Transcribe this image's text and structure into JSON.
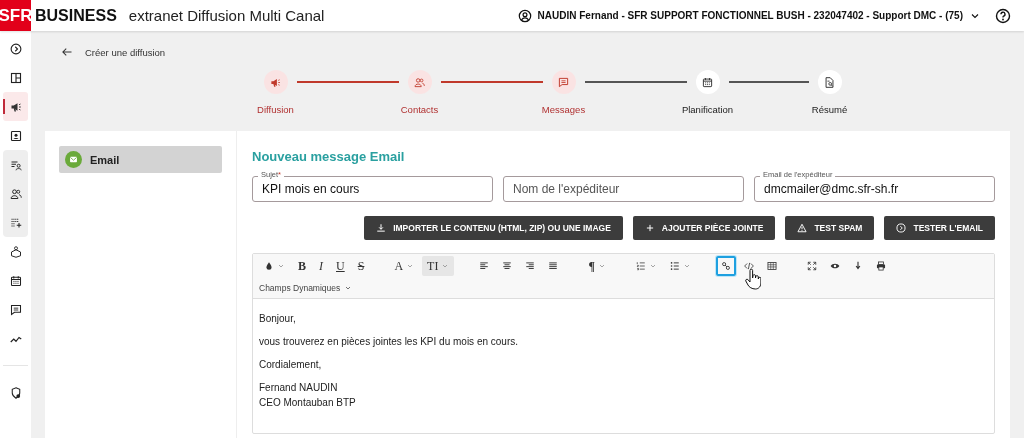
{
  "header": {
    "brand": "SFR",
    "product": "BUSINESS",
    "title": "extranet Diffusion Multi Canal",
    "user": "NAUDIN Fernand - SFR SUPPORT FONCTIONNEL BUSH - 232047402 - Support DMC - (75)"
  },
  "sidebar": {
    "groups": [
      {
        "shaded": false,
        "items": [
          {
            "selected": false
          },
          {
            "selected": false
          },
          {
            "selected": true
          },
          {
            "selected": false
          }
        ]
      },
      {
        "shaded": true,
        "items": [
          {
            "selected": false
          },
          {
            "selected": false
          },
          {
            "selected": false
          }
        ]
      },
      {
        "shaded": false,
        "items": [
          {
            "selected": false
          },
          {
            "selected": false
          },
          {
            "selected": false
          },
          {
            "selected": false
          }
        ]
      },
      {
        "shaded": false,
        "items": [
          {
            "selected": false
          }
        ]
      }
    ]
  },
  "back": {
    "label": "Créer une diffusion"
  },
  "steps": [
    {
      "label": "Diffusion",
      "completed": true
    },
    {
      "label": "Contacts",
      "completed": true
    },
    {
      "label": "Messages",
      "completed": true
    },
    {
      "label": "Planification",
      "completed": false
    },
    {
      "label": "Résumé",
      "completed": false
    }
  ],
  "channels": [
    {
      "label": "Email",
      "selected": true,
      "color": "#6aaa3a"
    }
  ],
  "form": {
    "title": "Nouveau message Email",
    "fields": [
      {
        "label": "Sujet",
        "required_mark": "*",
        "value": "KPI mois en cours"
      },
      {
        "placeholder": "Nom de l'expéditeur"
      },
      {
        "label": "Email de l'expéditeur",
        "value": "dmcmailer@dmc.sfr-sh.fr"
      }
    ],
    "buttons": [
      {
        "label": "IMPORTER LE CONTENU (HTML, ZIP) OU UNE IMAGE"
      },
      {
        "label": "AJOUTER PIÈCE JOINTE"
      },
      {
        "label": "TEST SPAM"
      },
      {
        "label": "TESTER L'EMAIL"
      }
    ]
  },
  "editor": {
    "toolbar": [
      [
        {
          "kind": "icon",
          "dropdown": true,
          "active": false,
          "focused": false
        },
        {
          "kind": "glyph",
          "text": "B",
          "dropdown": false,
          "active": false,
          "focused": false
        },
        {
          "kind": "glyph",
          "text": "I",
          "dropdown": false,
          "active": false,
          "focused": false
        },
        {
          "kind": "glyph",
          "text": "U",
          "dropdown": false,
          "active": false,
          "focused": false
        },
        {
          "kind": "glyph",
          "text": "S",
          "dropdown": false,
          "active": false,
          "focused": false
        }
      ],
      [
        {
          "kind": "glyph",
          "text": "A",
          "dropdown": true,
          "active": false,
          "focused": false
        },
        {
          "kind": "glyph",
          "text": "TI",
          "dropdown": true,
          "active": true,
          "focused": false
        }
      ],
      [
        {
          "kind": "icon",
          "dropdown": false,
          "active": false,
          "focused": false
        },
        {
          "kind": "icon",
          "dropdown": false,
          "active": false,
          "focused": false
        },
        {
          "kind": "icon",
          "dropdown": false,
          "active": false,
          "focused": false
        },
        {
          "kind": "icon",
          "dropdown": false,
          "active": false,
          "focused": false
        }
      ],
      [
        {
          "kind": "glyph",
          "text": "¶",
          "dropdown": true,
          "active": false,
          "focused": false
        }
      ],
      [
        {
          "kind": "icon",
          "dropdown": true,
          "active": false,
          "focused": false
        },
        {
          "kind": "icon",
          "dropdown": true,
          "active": false,
          "focused": false
        }
      ],
      [
        {
          "kind": "icon",
          "dropdown": false,
          "active": false,
          "focused": true
        },
        {
          "kind": "icon",
          "dropdown": false,
          "active": false,
          "focused": false
        },
        {
          "kind": "icon",
          "dropdown": false,
          "active": false,
          "focused": false
        }
      ],
      [
        {
          "kind": "icon",
          "dropdown": false,
          "active": false,
          "focused": false
        },
        {
          "kind": "icon",
          "dropdown": false,
          "active": false,
          "focused": false
        },
        {
          "kind": "icon",
          "dropdown": false,
          "active": false,
          "focused": false
        },
        {
          "kind": "icon",
          "dropdown": false,
          "active": false,
          "focused": false
        }
      ]
    ],
    "dynamic_fields": "Champs Dynamiques",
    "paragraphs": [
      [
        "Bonjour,"
      ],
      [
        "vous trouverez en pièces jointes les KPI du mois en cours."
      ],
      [
        "Cordialement,"
      ],
      [
        "Fernand NAUDIN",
        "CEO Montauban BTP"
      ]
    ]
  }
}
